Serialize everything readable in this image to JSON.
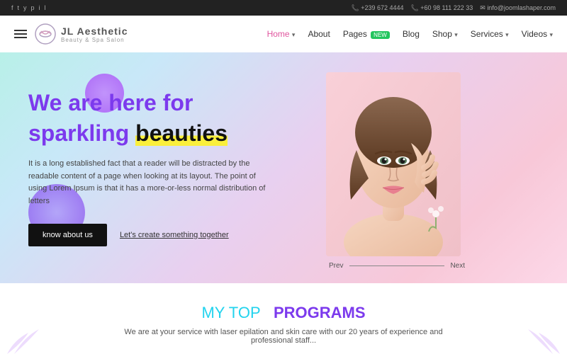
{
  "topbar": {
    "social_icons": [
      "facebook",
      "twitter",
      "youtube",
      "pinterest",
      "instagram",
      "linkedin"
    ],
    "phone1": "+239 672 4444",
    "phone2": "+60 98 111 222 33",
    "email": "info@joomlashaper.com"
  },
  "navbar": {
    "logo_title": "JL Aesthetic",
    "logo_subtitle": "Beauty & Spa Salon",
    "nav_items": [
      {
        "label": "Home",
        "active": true,
        "has_dropdown": true
      },
      {
        "label": "About",
        "active": false
      },
      {
        "label": "Pages",
        "active": false,
        "badge": "NEW"
      },
      {
        "label": "Blog",
        "active": false
      },
      {
        "label": "Shop",
        "active": false,
        "has_dropdown": true
      },
      {
        "label": "Services",
        "active": false,
        "has_dropdown": true
      },
      {
        "label": "Videos",
        "active": false,
        "has_dropdown": true
      }
    ]
  },
  "hero": {
    "title_line1": "We are here for",
    "title_line2_plain": "sparkling",
    "title_line2_bold": "beauties",
    "description": "It is a long established fact that a reader will be distracted by the readable content of a page when looking at its layout. The point of using Lorem Ipsum is that it has a more-or-less normal distribution of letters",
    "btn_primary": "know about us",
    "btn_link": "Let's create something together",
    "nav_prev": "Prev",
    "nav_next": "Next"
  },
  "programs": {
    "title_cyan": "MY TOP",
    "title_purple": "PROGRAMS",
    "description": "We are at your service with laser epilation and skin care with our 20 years of experience and professional staff..."
  }
}
